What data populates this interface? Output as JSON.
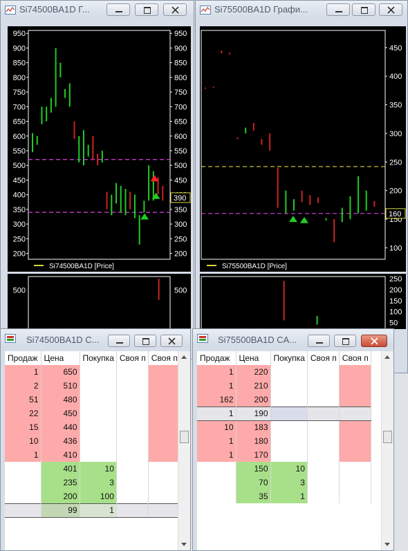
{
  "windows": {
    "chart_left": {
      "title": "Si74500BA1D Г...",
      "price_marker": "390"
    },
    "chart_right": {
      "title": "Si75500BA1D Графи...",
      "price_marker": "160"
    },
    "dom_left": {
      "title": "Si74500BA1D С..."
    },
    "dom_right": {
      "title": "Si75500BA1D CA..."
    }
  },
  "dom_columns": [
    "Продаж",
    "Цена",
    "ПокупкаСвоя пСвоя п"
  ],
  "dom_columns_split": [
    "Продаж",
    "Цена",
    "Покупка",
    "Своя п",
    "Своя п"
  ],
  "dom_left": {
    "rows": [
      {
        "sell": "1",
        "price": "650",
        "buy": "",
        "type": "sell"
      },
      {
        "sell": "2",
        "price": "510",
        "buy": "",
        "type": "sell"
      },
      {
        "sell": "51",
        "price": "480",
        "buy": "",
        "type": "sell"
      },
      {
        "sell": "22",
        "price": "450",
        "buy": "",
        "type": "sell"
      },
      {
        "sell": "15",
        "price": "440",
        "buy": "",
        "type": "sell"
      },
      {
        "sell": "10",
        "price": "436",
        "buy": "",
        "type": "sell"
      },
      {
        "sell": "1",
        "price": "410",
        "buy": "",
        "type": "sell"
      },
      {
        "sell": "",
        "price": "401",
        "buy": "10",
        "type": "buy"
      },
      {
        "sell": "",
        "price": "235",
        "buy": "3",
        "type": "buy"
      },
      {
        "sell": "",
        "price": "200",
        "buy": "100",
        "type": "buy"
      },
      {
        "sell": "",
        "price": "99",
        "buy": "1",
        "type": "buy-hl"
      }
    ]
  },
  "dom_right": {
    "rows": [
      {
        "sell": "1",
        "price": "220",
        "buy": "",
        "type": "sell"
      },
      {
        "sell": "1",
        "price": "210",
        "buy": "",
        "type": "sell"
      },
      {
        "sell": "162",
        "price": "200",
        "buy": "",
        "type": "sell"
      },
      {
        "sell": "1",
        "price": "190",
        "buy": "",
        "type": "sell-hl"
      },
      {
        "sell": "10",
        "price": "183",
        "buy": "",
        "type": "sell"
      },
      {
        "sell": "1",
        "price": "180",
        "buy": "",
        "type": "sell"
      },
      {
        "sell": "1",
        "price": "170",
        "buy": "",
        "type": "sell"
      },
      {
        "sell": "",
        "price": "150",
        "buy": "10",
        "type": "buy"
      },
      {
        "sell": "",
        "price": "70",
        "buy": "3",
        "type": "buy"
      },
      {
        "sell": "",
        "price": "35",
        "buy": "1",
        "type": "buy"
      }
    ]
  },
  "chart_data": [
    {
      "type": "bar",
      "title": "",
      "legend": "Si74500BA1D [Price]",
      "ylim": [
        180,
        960
      ],
      "yticks": [
        200,
        250,
        300,
        350,
        400,
        450,
        500,
        550,
        600,
        650,
        700,
        750,
        800,
        850,
        900,
        950
      ],
      "hlines": [
        {
          "value": 520,
          "color": "#e040e0"
        },
        {
          "value": 340,
          "color": "#e040e0"
        }
      ],
      "bars": [
        [
          545,
          610,
          "#22cc22"
        ],
        [
          570,
          600,
          "#22cc22"
        ],
        [
          640,
          700,
          "#22cc22"
        ],
        [
          650,
          700,
          "#22cc22"
        ],
        [
          680,
          730,
          "#22cc22"
        ],
        [
          700,
          900,
          "#22cc22"
        ],
        [
          800,
          850,
          "#22cc22"
        ],
        [
          730,
          760,
          "#22cc22"
        ],
        [
          700,
          780,
          "#22cc22"
        ],
        [
          590,
          650,
          "#cc2222"
        ],
        [
          510,
          600,
          "#22cc22"
        ],
        [
          500,
          620,
          "#22cc22"
        ],
        [
          530,
          570,
          "#22cc22"
        ],
        [
          520,
          600,
          "#cc2222"
        ],
        [
          500,
          540,
          "#cc2222"
        ],
        [
          510,
          550,
          "#22cc22"
        ],
        [
          350,
          410,
          "#cc2222"
        ],
        [
          330,
          400,
          "#22cc22"
        ],
        [
          370,
          440,
          "#22cc22"
        ],
        [
          340,
          430,
          "#22cc22"
        ],
        [
          330,
          420,
          "#22cc22"
        ],
        [
          350,
          410,
          "#cc2222"
        ],
        [
          320,
          400,
          "#22cc22"
        ],
        [
          230,
          330,
          "#22cc22"
        ],
        [
          340,
          380,
          "#22cc22"
        ],
        [
          380,
          500,
          "#22cc22"
        ],
        [
          380,
          480,
          "#22cc22"
        ],
        [
          400,
          460,
          "#cc2222"
        ],
        [
          380,
          430,
          "#cc2222"
        ]
      ],
      "markers": [
        {
          "value": 455,
          "color": "#ff2222"
        },
        {
          "value": 395,
          "color": "#22cc22"
        },
        {
          "value": 325,
          "color": "#22cc22"
        }
      ],
      "price_marker": 390,
      "sub": {
        "ylim": [
          300,
          570
        ],
        "yticks": [
          500
        ],
        "bars": [
          [
            450,
            560,
            "#cc2222"
          ]
        ]
      }
    },
    {
      "type": "bar",
      "title": "",
      "legend": "Si75500BA1D [Price]",
      "ylim": [
        80,
        480
      ],
      "yticks": [
        100,
        150,
        200,
        250,
        300,
        350,
        400,
        450
      ],
      "hlines": [
        {
          "value": 242,
          "color": "#d8d840"
        },
        {
          "value": 160,
          "color": "#e040e0"
        }
      ],
      "bars": [
        [
          378,
          380,
          "#cc2222"
        ],
        [
          380,
          382,
          "#cc2222"
        ],
        [
          440,
          445,
          "#cc2222"
        ],
        [
          438,
          441,
          "#cc2222"
        ],
        [
          290,
          293,
          "#cc2222"
        ],
        [
          300,
          310,
          "#22cc22"
        ],
        [
          305,
          318,
          "#cc2222"
        ],
        [
          280,
          290,
          "#cc2222"
        ],
        [
          270,
          300,
          "#cc2222"
        ],
        [
          170,
          240,
          "#cc2222"
        ],
        [
          160,
          200,
          "#22cc22"
        ],
        [
          165,
          185,
          "#22cc22"
        ],
        [
          180,
          200,
          "#cc2222"
        ],
        [
          175,
          192,
          "#cc2222"
        ],
        [
          178,
          188,
          "#cc2222"
        ],
        [
          148,
          152,
          "#22cc22"
        ],
        [
          110,
          150,
          "#cc2222"
        ],
        [
          145,
          170,
          "#22cc22"
        ],
        [
          150,
          190,
          "#22cc22"
        ],
        [
          160,
          225,
          "#22cc22"
        ],
        [
          165,
          200,
          "#22cc22"
        ],
        [
          172,
          182,
          "#cc2222"
        ]
      ],
      "markers": [
        {
          "value": 150,
          "color": "#22cc22"
        },
        {
          "value": 148,
          "color": "#22cc22"
        }
      ],
      "price_marker": 160,
      "sub": {
        "ylim": [
          20,
          260
        ],
        "yticks": [
          50,
          100,
          150,
          200,
          250
        ],
        "bars": [
          [
            60,
            240,
            "#cc2222"
          ],
          [
            40,
            80,
            "#22cc22"
          ]
        ]
      }
    }
  ],
  "colors": {
    "accent_close": "#c84a33",
    "chart_bg": "#000000",
    "axis_text": "#ffffff"
  }
}
